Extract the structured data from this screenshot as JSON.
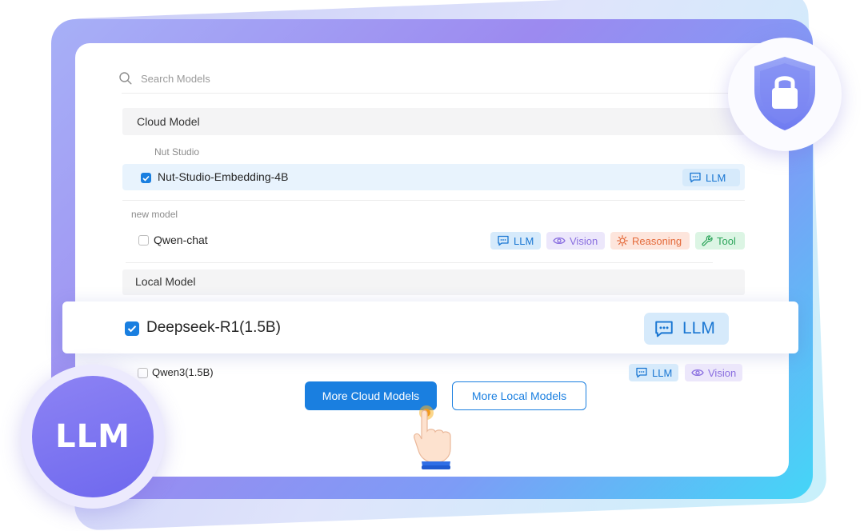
{
  "search": {
    "placeholder": "Search Models"
  },
  "groups": {
    "cloud": {
      "label": "Cloud Model",
      "providers": [
        {
          "name": "Nut Studio",
          "models": [
            {
              "name": "Nut-Studio-Embedding-4B",
              "checked": true,
              "tags": [
                "LLM"
              ]
            }
          ]
        },
        {
          "name": "new model",
          "models": [
            {
              "name": "Qwen-chat",
              "checked": false,
              "tags": [
                "LLM",
                "Vision",
                "Reasoning",
                "Tool"
              ]
            }
          ]
        }
      ]
    },
    "local": {
      "label": "Local Model",
      "models": [
        {
          "name": "Deepseek-R1(1.5B)",
          "checked": true,
          "tags": [
            "LLM"
          ]
        },
        {
          "name": "Qwen3(1.5B)",
          "checked": false,
          "tags": [
            "LLM",
            "Vision"
          ]
        }
      ]
    }
  },
  "buttons": {
    "more_cloud": "More Cloud Models",
    "more_local": "More Local Models"
  },
  "badges": {
    "llm": "LLM",
    "shield_icon": "shield-lock-icon"
  },
  "icons": {
    "search": "search-icon",
    "llm": "chat-bubble-icon",
    "vision": "eye-icon",
    "reasoning": "sun-icon",
    "tool": "wrench-icon",
    "cursor": "hand-pointer-icon"
  },
  "colors": {
    "accent": "#1a7fe0",
    "llm_tag": "#1976d2",
    "vision_tag": "#8a6fe0",
    "reasoning_tag": "#e46a3a",
    "tool_tag": "#2da55b",
    "badge_purple": "#7a73f0"
  }
}
